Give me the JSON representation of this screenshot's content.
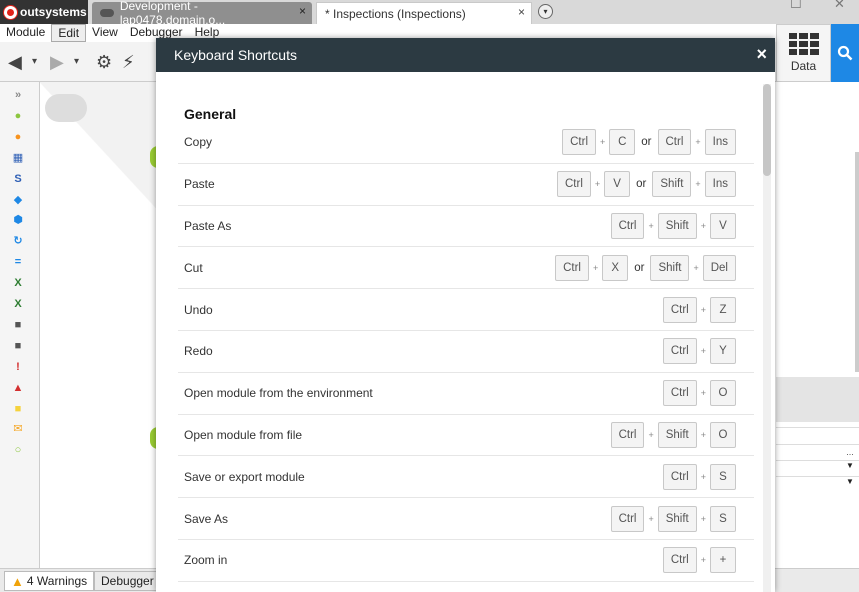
{
  "tabs": {
    "brand": "outsystems",
    "development": "Development - lap0478.domain.o...",
    "inspections": "* Inspections (Inspections)",
    "close": "×",
    "dropdown": "▾"
  },
  "window": {
    "minimize": "☐",
    "close": "✕"
  },
  "menu": [
    "Module",
    "Edit",
    "View",
    "Debugger",
    "Help"
  ],
  "toolbar": {
    "data_label": "Data"
  },
  "bottom": {
    "warnings": "4 Warnings",
    "debugger": "Debugger"
  },
  "modal": {
    "title": "Keyboard Shortcuts",
    "close": "×",
    "section": "General",
    "shortcuts": [
      {
        "label": "Copy",
        "groups": [
          [
            "Ctrl",
            "C"
          ],
          [
            "Ctrl",
            "Ins"
          ]
        ]
      },
      {
        "label": "Paste",
        "groups": [
          [
            "Ctrl",
            "V"
          ],
          [
            "Shift",
            "Ins"
          ]
        ]
      },
      {
        "label": "Paste As",
        "groups": [
          [
            "Ctrl",
            "Shift",
            "V"
          ]
        ]
      },
      {
        "label": "Cut",
        "groups": [
          [
            "Ctrl",
            "X"
          ],
          [
            "Shift",
            "Del"
          ]
        ]
      },
      {
        "label": "Undo",
        "groups": [
          [
            "Ctrl",
            "Z"
          ]
        ]
      },
      {
        "label": "Redo",
        "groups": [
          [
            "Ctrl",
            "Y"
          ]
        ]
      },
      {
        "label": "Open module from the environment",
        "groups": [
          [
            "Ctrl",
            "O"
          ]
        ]
      },
      {
        "label": "Open module from file",
        "groups": [
          [
            "Ctrl",
            "Shift",
            "O"
          ]
        ]
      },
      {
        "label": "Save or export module",
        "groups": [
          [
            "Ctrl",
            "S"
          ]
        ]
      },
      {
        "label": "Save As",
        "groups": [
          [
            "Ctrl",
            "Shift",
            "S"
          ]
        ]
      },
      {
        "label": "Zoom in",
        "groups": [
          [
            "Ctrl",
            "+"
          ]
        ]
      }
    ],
    "or_text": "or",
    "plus_text": "+"
  },
  "palette_icons": [
    {
      "name": "expand-icon",
      "glyph": "»",
      "color": "#888888"
    },
    {
      "name": "start-icon",
      "glyph": "●",
      "color": "#8cc63f"
    },
    {
      "name": "end-icon",
      "glyph": "●",
      "color": "#f7931e"
    },
    {
      "name": "aggregate-icon",
      "glyph": "▦",
      "color": "#2e5fb5"
    },
    {
      "name": "sql-icon",
      "glyph": "S",
      "color": "#2e5fb5"
    },
    {
      "name": "if-icon",
      "glyph": "◆",
      "color": "#1e88e5"
    },
    {
      "name": "switch-icon",
      "glyph": "⬢",
      "color": "#1e88e5"
    },
    {
      "name": "foreach-icon",
      "glyph": "↻",
      "color": "#1e88e5"
    },
    {
      "name": "assign-icon",
      "glyph": "=",
      "color": "#1e88e5"
    },
    {
      "name": "excel-to-record-icon",
      "glyph": "X",
      "color": "#2e7d32"
    },
    {
      "name": "record-to-excel-icon",
      "glyph": "X",
      "color": "#2e7d32"
    },
    {
      "name": "json-serialize-icon",
      "glyph": "■",
      "color": "#555555"
    },
    {
      "name": "json-deserialize-icon",
      "glyph": "■",
      "color": "#555555"
    },
    {
      "name": "exception-icon",
      "glyph": "!",
      "color": "#d32f2f"
    },
    {
      "name": "raise-exception-icon",
      "glyph": "▲",
      "color": "#d32f2f"
    },
    {
      "name": "comment-icon",
      "glyph": "■",
      "color": "#f5d23c"
    },
    {
      "name": "send-email-icon",
      "glyph": "✉",
      "color": "#f5a623"
    },
    {
      "name": "end-node-icon",
      "glyph": "○",
      "color": "#8cc63f"
    }
  ]
}
